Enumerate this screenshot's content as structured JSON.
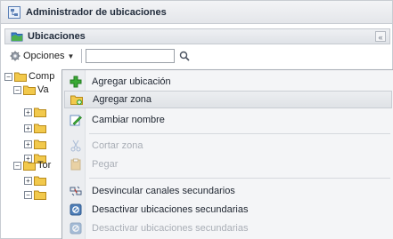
{
  "window": {
    "title": "Administrador de ubicaciones"
  },
  "panel": {
    "title": "Ubicaciones",
    "collapse_label": "«"
  },
  "toolbar": {
    "options_label": "Opciones",
    "search_value": "",
    "search_placeholder": ""
  },
  "tree": {
    "items": [
      {
        "label": "Comp",
        "toggle": "−"
      },
      {
        "label": "Va",
        "toggle": "−"
      },
      {
        "label": "",
        "toggle": "+"
      },
      {
        "label": "",
        "toggle": "+"
      },
      {
        "label": "",
        "toggle": "+"
      },
      {
        "label": "",
        "toggle": "+"
      },
      {
        "label": "Tor",
        "toggle": "−"
      },
      {
        "label": "",
        "toggle": "+"
      },
      {
        "label": "",
        "toggle": "−"
      }
    ]
  },
  "context_menu": {
    "items": [
      {
        "label": "Agregar ubicación",
        "icon": "plus-icon",
        "enabled": true
      },
      {
        "label": "Agregar zona",
        "icon": "add-zone-icon",
        "enabled": true,
        "highlighted": true
      },
      {
        "label": "Cambiar nombre",
        "icon": "rename-icon",
        "enabled": true
      },
      {
        "label": "Cortar zona",
        "icon": "cut-icon",
        "enabled": false
      },
      {
        "label": "Pegar",
        "icon": "paste-icon",
        "enabled": false
      },
      {
        "label": "Desvincular canales secundarios",
        "icon": "unlink-icon",
        "enabled": true
      },
      {
        "label": "Desactivar ubicaciones secundarias",
        "icon": "deactivate-icon",
        "enabled": true
      },
      {
        "label": "Desactivar ubicaciones secundarias",
        "icon": "deactivate-icon",
        "enabled": false
      }
    ]
  },
  "colors": {
    "accent_green": "#3aa935",
    "folder_yellow": "#f2c94c",
    "highlight": "#dfe2e6"
  }
}
